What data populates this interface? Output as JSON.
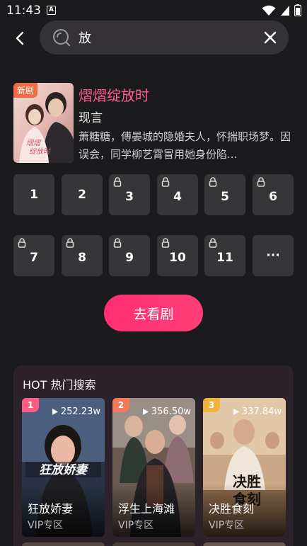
{
  "status_bar": {
    "time": "11:43",
    "notification_glyph": "A"
  },
  "search": {
    "query": "放",
    "placeholder": ""
  },
  "result": {
    "badge": "新剧",
    "title": "熠熠绽放时",
    "genre": "现言",
    "description": "萧糖糖，傅晏城的隐婚夫人，怀揣职场梦。因误会，同学柳艺霄冒用她身份陷..."
  },
  "episodes": [
    {
      "label": "1",
      "locked": false
    },
    {
      "label": "2",
      "locked": false
    },
    {
      "label": "3",
      "locked": true
    },
    {
      "label": "4",
      "locked": true
    },
    {
      "label": "5",
      "locked": true
    },
    {
      "label": "6",
      "locked": true
    },
    {
      "label": "7",
      "locked": true
    },
    {
      "label": "8",
      "locked": true
    },
    {
      "label": "9",
      "locked": true
    },
    {
      "label": "10",
      "locked": true
    },
    {
      "label": "11",
      "locked": true
    },
    {
      "label": "···",
      "locked": false
    }
  ],
  "watch_button": "去看剧",
  "hot": {
    "title": "HOT 热门搜索",
    "items": [
      {
        "rank": "1",
        "plays": "252.23w",
        "name": "狂放娇妻",
        "sub": "VIP专区",
        "rank_color": "#ff5d86"
      },
      {
        "rank": "2",
        "plays": "356.50w",
        "name": "浮生上海滩",
        "sub": "VIP专区",
        "rank_color": "#f4795a"
      },
      {
        "rank": "3",
        "plays": "337.84w",
        "name": "决胜食刻",
        "sub": "VIP专区",
        "rank_color": "#f0b43c"
      }
    ]
  },
  "colors": {
    "accent": "#ff2e73",
    "title_pink": "#ff5c8f",
    "background": "#1b1a1d"
  }
}
